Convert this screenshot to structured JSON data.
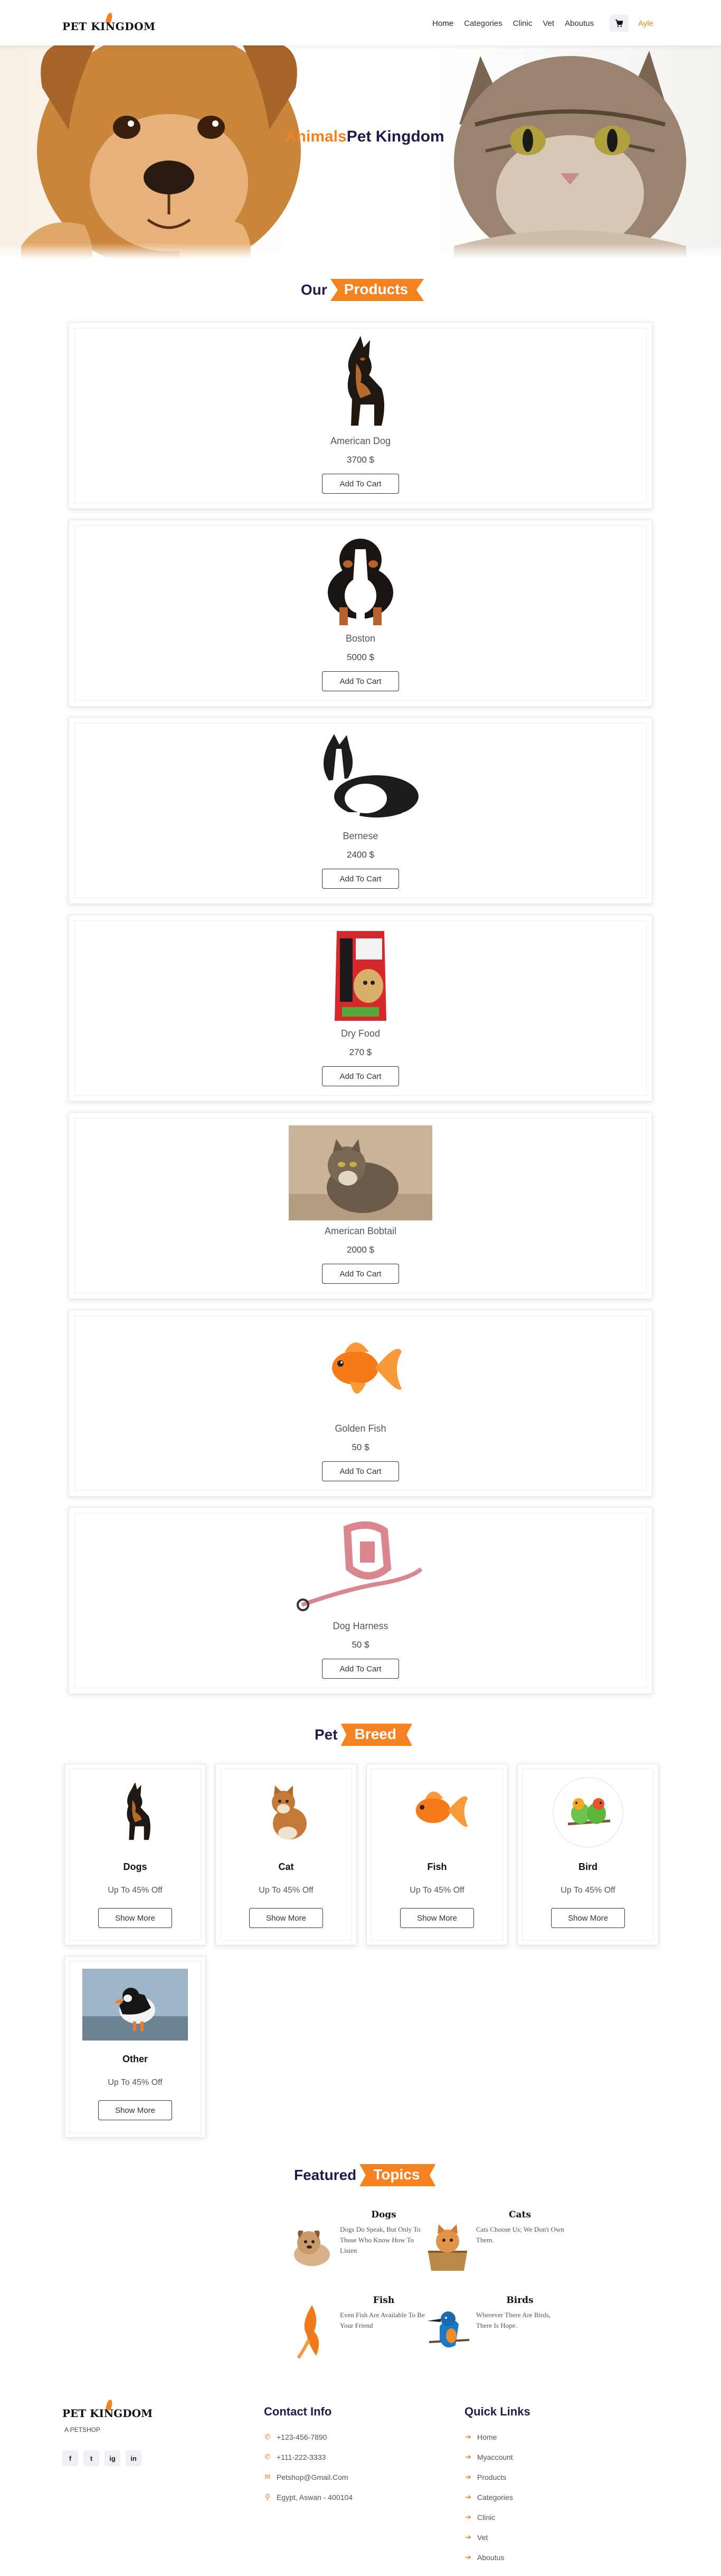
{
  "nav": {
    "logo_text": "PET KINGDOM",
    "links": [
      "Home",
      "Categories",
      "Clinic",
      "Vet",
      "Aboutus"
    ],
    "user": "Ayle"
  },
  "hero": {
    "title_accent": "Animals",
    "title_main": "Pet Kingdom"
  },
  "products_section": {
    "title_a": "Our",
    "title_b": "Products"
  },
  "products": [
    {
      "name": "American Dog",
      "price": "3700 $",
      "button": "Add To Cart"
    },
    {
      "name": "Boston",
      "price": "5000 $",
      "button": "Add To Cart"
    },
    {
      "name": "Bernese",
      "price": "2400 $",
      "button": "Add To Cart"
    },
    {
      "name": "Dry Food",
      "price": "270 $",
      "button": "Add To Cart"
    },
    {
      "name": "American Bobtail",
      "price": "2000 $",
      "button": "Add To Cart"
    },
    {
      "name": "Golden Fish",
      "price": "50 $",
      "button": "Add To Cart"
    },
    {
      "name": "Dog Harness",
      "price": "50 $",
      "button": "Add To Cart"
    }
  ],
  "breed_section": {
    "title_a": "Pet",
    "title_b": "Breed"
  },
  "breeds": [
    {
      "name": "Dogs",
      "offer": "Up To 45% Off",
      "button": "Show More"
    },
    {
      "name": "Cat",
      "offer": "Up To 45% Off",
      "button": "Show More"
    },
    {
      "name": "Fish",
      "offer": "Up To 45% Off",
      "button": "Show More"
    },
    {
      "name": "Bird",
      "offer": "Up To 45% Off",
      "button": "Show More"
    },
    {
      "name": "Other",
      "offer": "Up To 45% Off",
      "button": "Show More"
    }
  ],
  "topics_section": {
    "title_a": "Featured",
    "title_b": "Topics"
  },
  "topics": [
    {
      "title": "Dogs",
      "text": "Dogs Do Speak, But Only To Those Who Know How To Listen"
    },
    {
      "title": "Cats",
      "text": "Cats Choose Us; We Don't Own Them."
    },
    {
      "title": "Fish",
      "text": "Even Fish Are Available To Be Your Friend"
    },
    {
      "title": "Birds",
      "text": "Wherever There Are Birds, There Is Hope."
    }
  ],
  "footer": {
    "logo_text": "PET KINGDOM",
    "tagline": "A PETSHOP",
    "socials": [
      "f",
      "t",
      "ig",
      "in"
    ],
    "contact_heading": "Contact Info",
    "contacts": [
      "+123-456-7890",
      "+111-222-3333",
      "Petshop@Gmail.Com",
      "Egypt, Aswan - 400104"
    ],
    "links_heading": "Quick Links",
    "links": [
      "Home",
      "Myaccount",
      "Products",
      "Categories",
      "Clinic",
      "Vet",
      "Aboutus"
    ]
  },
  "colors": {
    "accent": "#f58220",
    "navy": "#1d1d4b"
  },
  "icons": [
    "cart-icon",
    "phone-icon",
    "email-icon",
    "location-icon",
    "arrow-right-icon",
    "facebook-icon",
    "twitter-icon",
    "instagram-icon",
    "linkedin-icon"
  ]
}
